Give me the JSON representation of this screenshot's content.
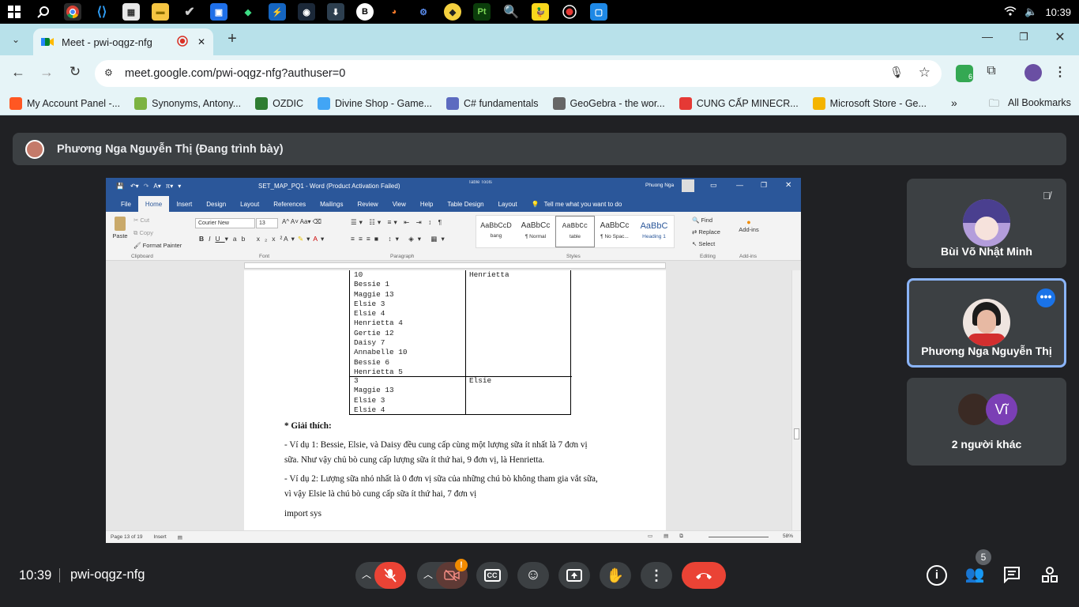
{
  "taskbar": {
    "apps": [
      "windows-start-icon",
      "search-icon",
      "chrome-icon",
      "vscode-icon",
      "office-tool-icon",
      "file-explorer-icon",
      "check-icon",
      "app-blue-icon",
      "android-studio-icon",
      "app-blue-square-icon",
      "steam-icon",
      "app-download-icon",
      "app-b-icon",
      "blender-icon",
      "settings-gear-icon",
      "app-yellow-icon",
      "photoshop-icon",
      "app-orange-icon",
      "duck-icon",
      "record-icon",
      "app-screen-icon"
    ],
    "time": "10:39"
  },
  "browser": {
    "tab_title": "Meet - pwi-oqgz-nfg",
    "url": "meet.google.com/pwi-oqgz-nfg?authuser=0",
    "extension_badge": "6",
    "bookmarks": [
      {
        "label": "My Account Panel -...",
        "color": "#ff5722"
      },
      {
        "label": "Synonyms, Antony...",
        "color": "#7cb342"
      },
      {
        "label": "OZDIC",
        "color": "#2e7d32"
      },
      {
        "label": "Divine Shop - Game...",
        "color": "#42a5f5"
      },
      {
        "label": "C# fundamentals",
        "color": "#5c6bc0"
      },
      {
        "label": "GeoGebra - the wor...",
        "color": "#666666"
      },
      {
        "label": "CUNG CẤP MINECR...",
        "color": "#e53935"
      },
      {
        "label": "Microsoft Store - Ge...",
        "color": "#f4b400"
      }
    ],
    "all_bookmarks": "All Bookmarks"
  },
  "meet": {
    "presenter_label": "Phương Nga Nguyễn Thị (Đang trình bày)",
    "meeting_time": "10:39",
    "meeting_code": "pwi-oqgz-nfg",
    "participants_count": "5",
    "participants": [
      {
        "name": "Bùi Võ Nhật Minh"
      },
      {
        "name": "Phương Nga Nguyễn Thị"
      },
      {
        "name": "2 người khác",
        "avatar_letter": "Vĩ"
      }
    ]
  },
  "word": {
    "title": "SET_MAP_PQ1 - Word (Product Activation Failed)",
    "table_tools": "Table Tools",
    "user": "Phuong Nga",
    "tabs": [
      "File",
      "Home",
      "Insert",
      "Design",
      "Layout",
      "References",
      "Mailings",
      "Review",
      "View",
      "Help",
      "Table Design",
      "Layout"
    ],
    "tell_me": "Tell me what you want to do",
    "clipboard": {
      "paste": "Paste",
      "cut": "Cut",
      "copy": "Copy",
      "format_painter": "Format Painter",
      "group": "Clipboard"
    },
    "font": {
      "name": "Courier New",
      "size": "13",
      "group": "Font"
    },
    "paragraph_group": "Paragraph",
    "styles": [
      {
        "preview": "AaBbCcD",
        "name": "bang"
      },
      {
        "preview": "AaBbCc",
        "name": "¶ Normal"
      },
      {
        "preview": "AaBbCc",
        "name": "table"
      },
      {
        "preview": "AaBbCc",
        "name": "¶ No Spac..."
      },
      {
        "preview": "AaBbC",
        "name": "Heading 1"
      }
    ],
    "styles_group": "Styles",
    "editing": {
      "find": "Find",
      "replace": "Replace",
      "select": "Select",
      "group": "Editing"
    },
    "addins": {
      "label": "Add-ins",
      "group": "Add-ins"
    },
    "cell1_lines": [
      "10",
      "Bessie 1",
      "Maggie 13",
      "Elsie 3",
      "Elsie 4",
      "Henrietta 4",
      "Gertie 12",
      "Daisy 7",
      "Annabelle 10",
      "Bessie 6",
      "Henrietta 5"
    ],
    "cell1_right": "Henrietta",
    "cell2_lines": [
      "3",
      "Maggie 13",
      "Elsie 3",
      "Elsie 4"
    ],
    "cell2_right": "Elsie",
    "explain_heading": "* Giải thích:",
    "para1_line1": "- Ví dụ 1: Bessie, Elsie, và Daisy đều cung cấp cùng một lượng sữa ít nhất là 7 đơn vị",
    "para1_line2": "sữa. Như vậy chủ bò cung cấp lượng sữa ít thứ hai, 9 đơn vị, là Henrietta.",
    "para2_line1": "- Ví dụ 2: Lượng sữa nhỏ nhất là 0 đơn vị sữa của những chú bò không tham gia vắt sữa,",
    "para2_line2": "vì vậy Elsie là chú bò cung cấp sữa ít thứ hai, 7 đơn vị",
    "code_line": "import sys",
    "status_page": "Page 13 of 19",
    "status_mode": "Insert",
    "zoom": "58%"
  },
  "colors": {
    "hangup": "#ea4335",
    "word_blue": "#2b579a",
    "active_tile_border": "#8ab4f8",
    "warn": "#f28b00"
  }
}
